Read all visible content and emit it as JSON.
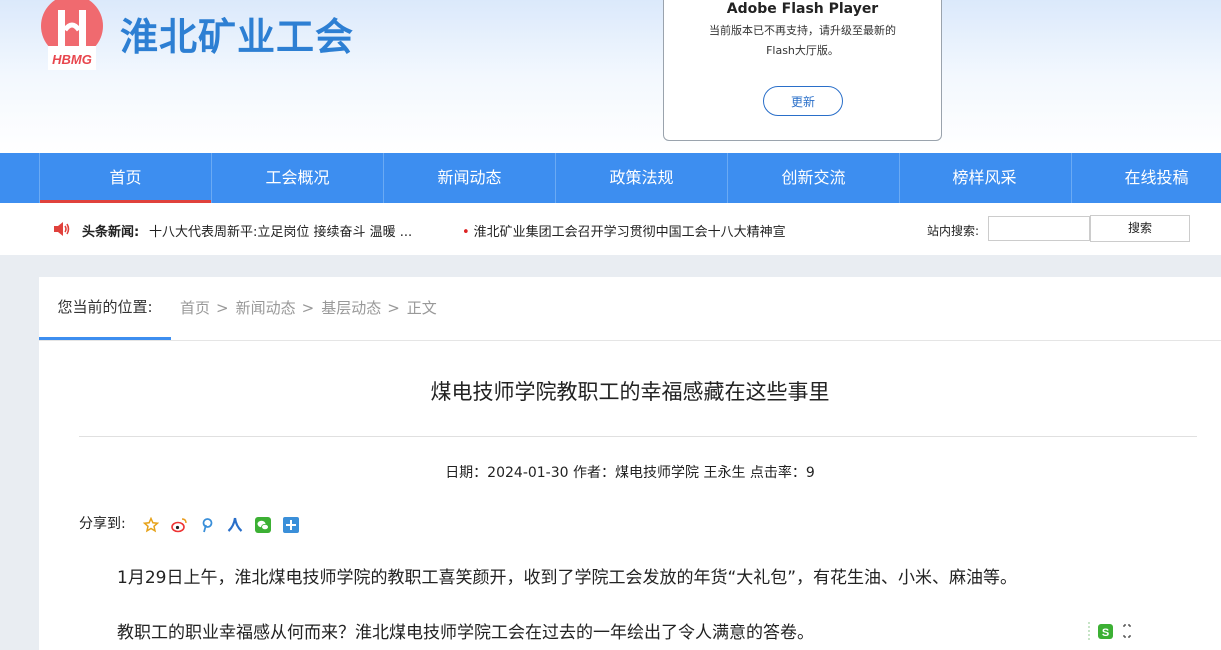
{
  "header": {
    "logo_text": "HBMG",
    "site_title": "淮北矿业工会"
  },
  "flash_popup": {
    "title": "Adobe Flash Player",
    "text": "当前版本已不再支持，请升级至最新的Flash大厅版。",
    "update_button": "更新"
  },
  "nav": {
    "items": [
      "首页",
      "工会概况",
      "新闻动态",
      "政策法规",
      "创新交流",
      "榜样风采",
      "在线投稿"
    ],
    "active_index": 0
  },
  "ticker": {
    "label": "头条新闻:",
    "headline": "十八大代表周新平:立足岗位 接续奋斗 温暖 ...",
    "item2": "淮北矿业集团工会召开学习贯彻中国工会十八大精神宣"
  },
  "search": {
    "label": "站内搜索:",
    "button": "搜索",
    "value": ""
  },
  "breadcrumb": {
    "label": "您当前的位置:",
    "items": [
      "首页",
      "新闻动态",
      "基层动态",
      "正文"
    ],
    "separator": ">"
  },
  "article": {
    "title": "煤电技师学院教职工的幸福感藏在这些事里",
    "meta": "日期：2024-01-30 作者：煤电技师学院 王永生 点击率：9",
    "share_label": "分享到:",
    "share_icons": [
      "favorite-icon",
      "weibo-icon",
      "pinterest-icon",
      "renren-icon",
      "wechat-icon",
      "more-share-icon"
    ],
    "paragraphs": [
      "1月29日上午，淮北煤电技师学院的教职工喜笑颜开，收到了学院工会发放的年货“大礼包”，有花生油、小米、麻油等。",
      "教职工的职业幸福感从何而来？淮北煤电技师学院工会在过去的一年绘出了令人满意的答卷。"
    ]
  },
  "colors": {
    "nav_bg": "#3d8ef0",
    "title_blue": "#2d7fd3",
    "active_underline": "#e0413c",
    "logo_red": "#f06a6f"
  }
}
